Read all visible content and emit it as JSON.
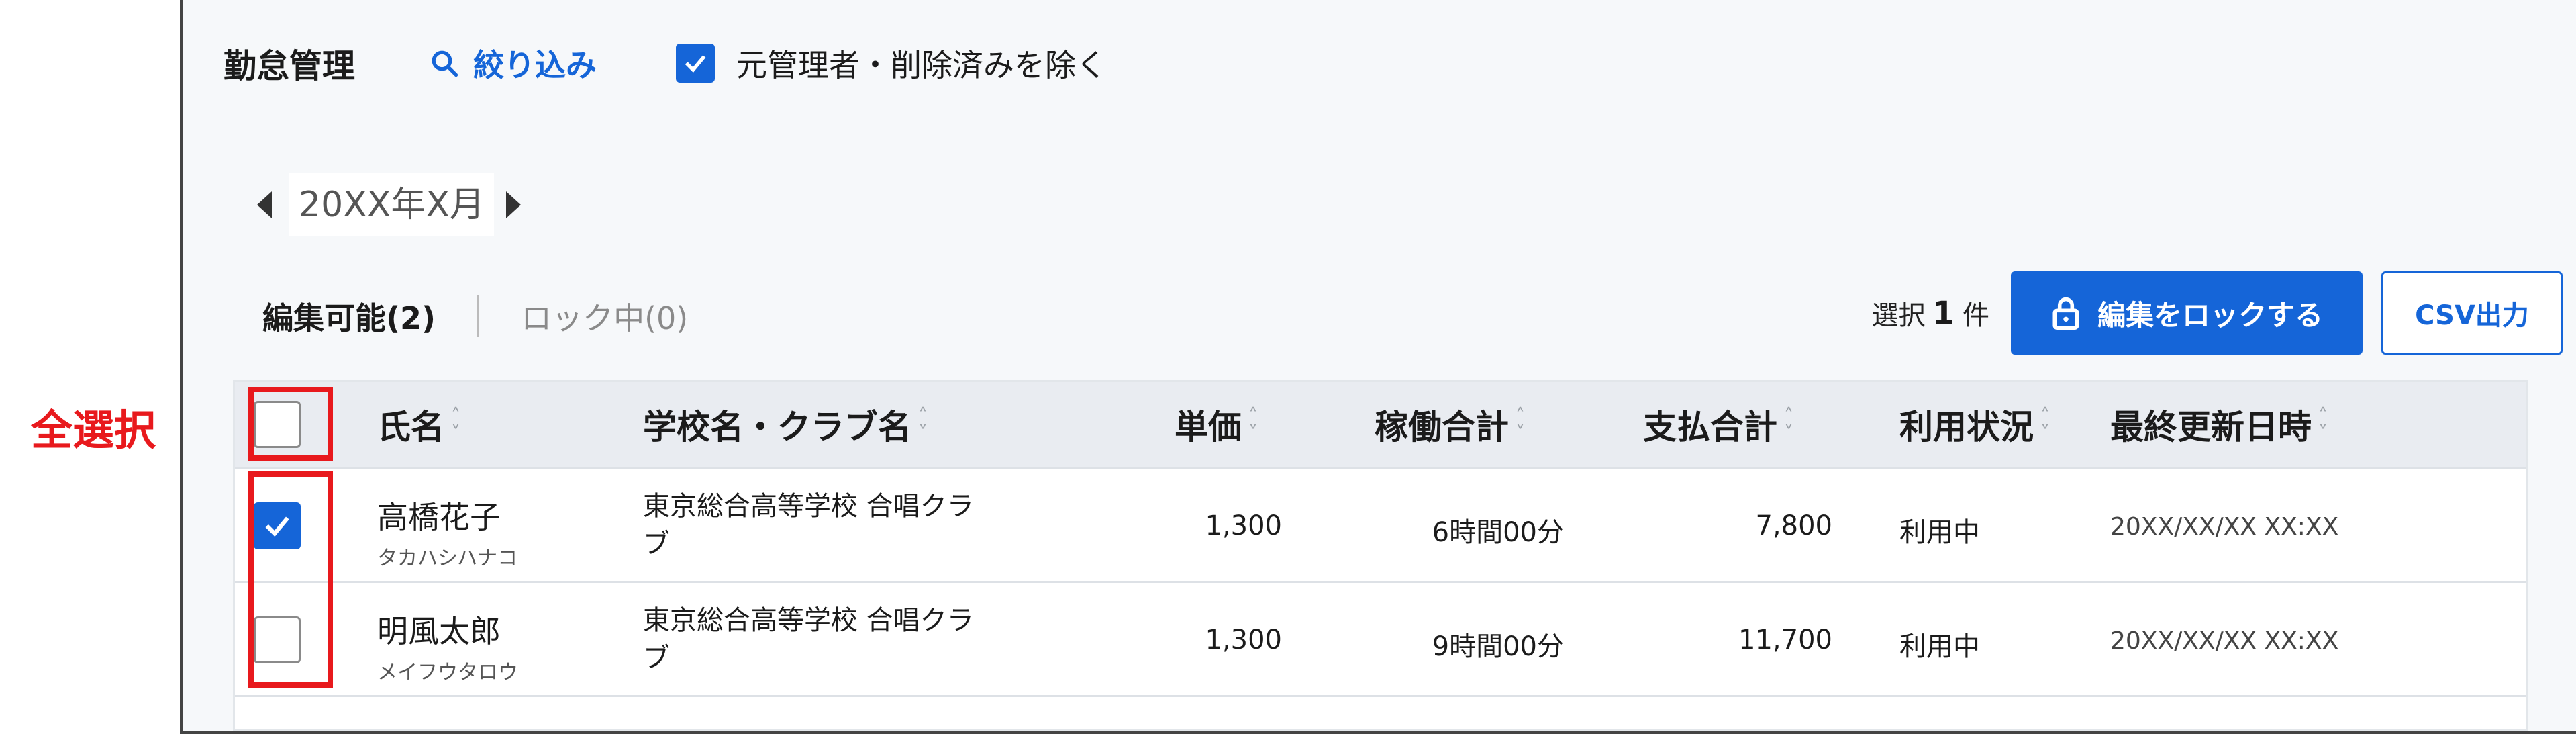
{
  "annotation": {
    "label": "全選択"
  },
  "header": {
    "title": "勤怠管理",
    "filter_label": "絞り込み",
    "exclude_label": "元管理者・削除済みを除く",
    "exclude_checked": true
  },
  "month": {
    "label": "20XX年X月"
  },
  "tabs": {
    "editable": "編集可能(2)",
    "locked": "ロック中(0)"
  },
  "selection": {
    "prefix": "選択",
    "count": "1",
    "suffix": "件"
  },
  "buttons": {
    "lock": "編集をロックする",
    "csv": "CSV出力"
  },
  "table": {
    "columns": [
      "氏名",
      "学校名・クラブ名",
      "単価",
      "稼働合計",
      "支払合計",
      "利用状況",
      "最終更新日時"
    ],
    "rows": [
      {
        "checked": true,
        "name": "高橋花子",
        "kana": "タカハシハナコ",
        "school_line1": "東京総合高等学校 合唱クラ",
        "school_line2": "ブ",
        "price": "1,300",
        "hours": "6時間00分",
        "total": "7,800",
        "status": "利用中",
        "updated": "20XX/XX/XX XX:XX"
      },
      {
        "checked": false,
        "name": "明風太郎",
        "kana": "メイフウタロウ",
        "school_line1": "東京総合高等学校 合唱クラ",
        "school_line2": "ブ",
        "price": "1,300",
        "hours": "9時間00分",
        "total": "11,700",
        "status": "利用中",
        "updated": "20XX/XX/XX XX:XX"
      }
    ]
  },
  "colors": {
    "accent": "#1565d8",
    "annotation": "#e8191d"
  }
}
